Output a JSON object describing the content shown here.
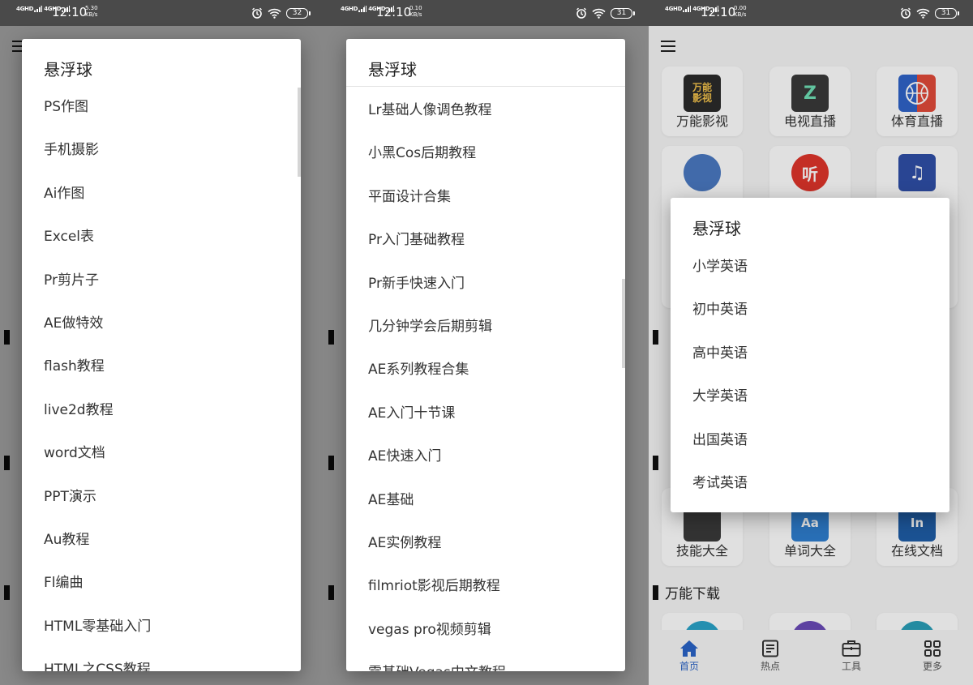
{
  "statusbar": {
    "net1": "4GHD",
    "net2": "4GHD",
    "time": "12:10",
    "screens": [
      {
        "speed": "5.30",
        "speed_unit": "KB/s",
        "battery": "32"
      },
      {
        "speed": "0.10",
        "speed_unit": "KB/s",
        "battery": "31"
      },
      {
        "speed": "0.00",
        "speed_unit": "KB/s",
        "battery": "31"
      }
    ]
  },
  "dialog1": {
    "title": "悬浮球",
    "items": [
      "PS作图",
      "手机摄影",
      "Ai作图",
      "Excel表",
      "Pr剪片子",
      "AE做特效",
      "flash教程",
      "live2d教程",
      "word文档",
      "PPT演示",
      "Au教程",
      "Fl编曲",
      "HTML零基础入门",
      "HTML之CSS教程"
    ]
  },
  "dialog2": {
    "title": "悬浮球",
    "items": [
      "Lr基础人像调色教程",
      "小黑Cos后期教程",
      "平面设计合集",
      "Pr入门基础教程",
      "Pr新手快速入门",
      "几分钟学会后期剪辑",
      "AE系列教程合集",
      "AE入门十节课",
      "AE快速入门",
      "AE基础",
      "AE实例教程",
      "filmriot影视后期教程",
      "vegas pro视频剪辑",
      "零基础Vegas中文教程"
    ]
  },
  "dialog3": {
    "title": "悬浮球",
    "items": [
      "小学英语",
      "初中英语",
      "高中英语",
      "大学英语",
      "出国英语",
      "考试英语"
    ]
  },
  "app": {
    "tiles_row1": [
      {
        "label": "万能影视",
        "icon": "film-icon",
        "text": "万能影视",
        "color": "#2b2b2b"
      },
      {
        "label": "电视直播",
        "icon": "tv-icon",
        "text": "Z",
        "color": "#3a3a3a"
      },
      {
        "label": "体育直播",
        "icon": "basketball-icon",
        "text": "",
        "color": "#2f64c9"
      }
    ],
    "tiles_row2": [
      {
        "label": "",
        "icon": "anime-icon",
        "color": "#4a79c2"
      },
      {
        "label": "",
        "icon": "listen-icon",
        "text": "听",
        "color": "#e0352b"
      },
      {
        "label": "",
        "icon": "music-icon",
        "text": "♫",
        "color": "#2f4fa8"
      }
    ],
    "tiles_row3": [
      {
        "label": "技能大全",
        "icon": "skills-icon",
        "color": "#3b3b3b"
      },
      {
        "label": "单词大全",
        "icon": "dictionary-icon",
        "text": "Aa",
        "color": "#2f7fd0"
      },
      {
        "label": "在线文档",
        "icon": "document-icon",
        "text": "In",
        "color": "#1f5ea8"
      }
    ],
    "section_download": "万能下载",
    "nav": [
      {
        "label": "首页",
        "icon": "home-icon"
      },
      {
        "label": "热点",
        "icon": "news-icon"
      },
      {
        "label": "工具",
        "icon": "toolbox-icon"
      },
      {
        "label": "更多",
        "icon": "grid-icon"
      }
    ],
    "colors": {
      "accent": "#2a63c8",
      "overlay": "rgba(0,0,0,0.45)"
    }
  }
}
